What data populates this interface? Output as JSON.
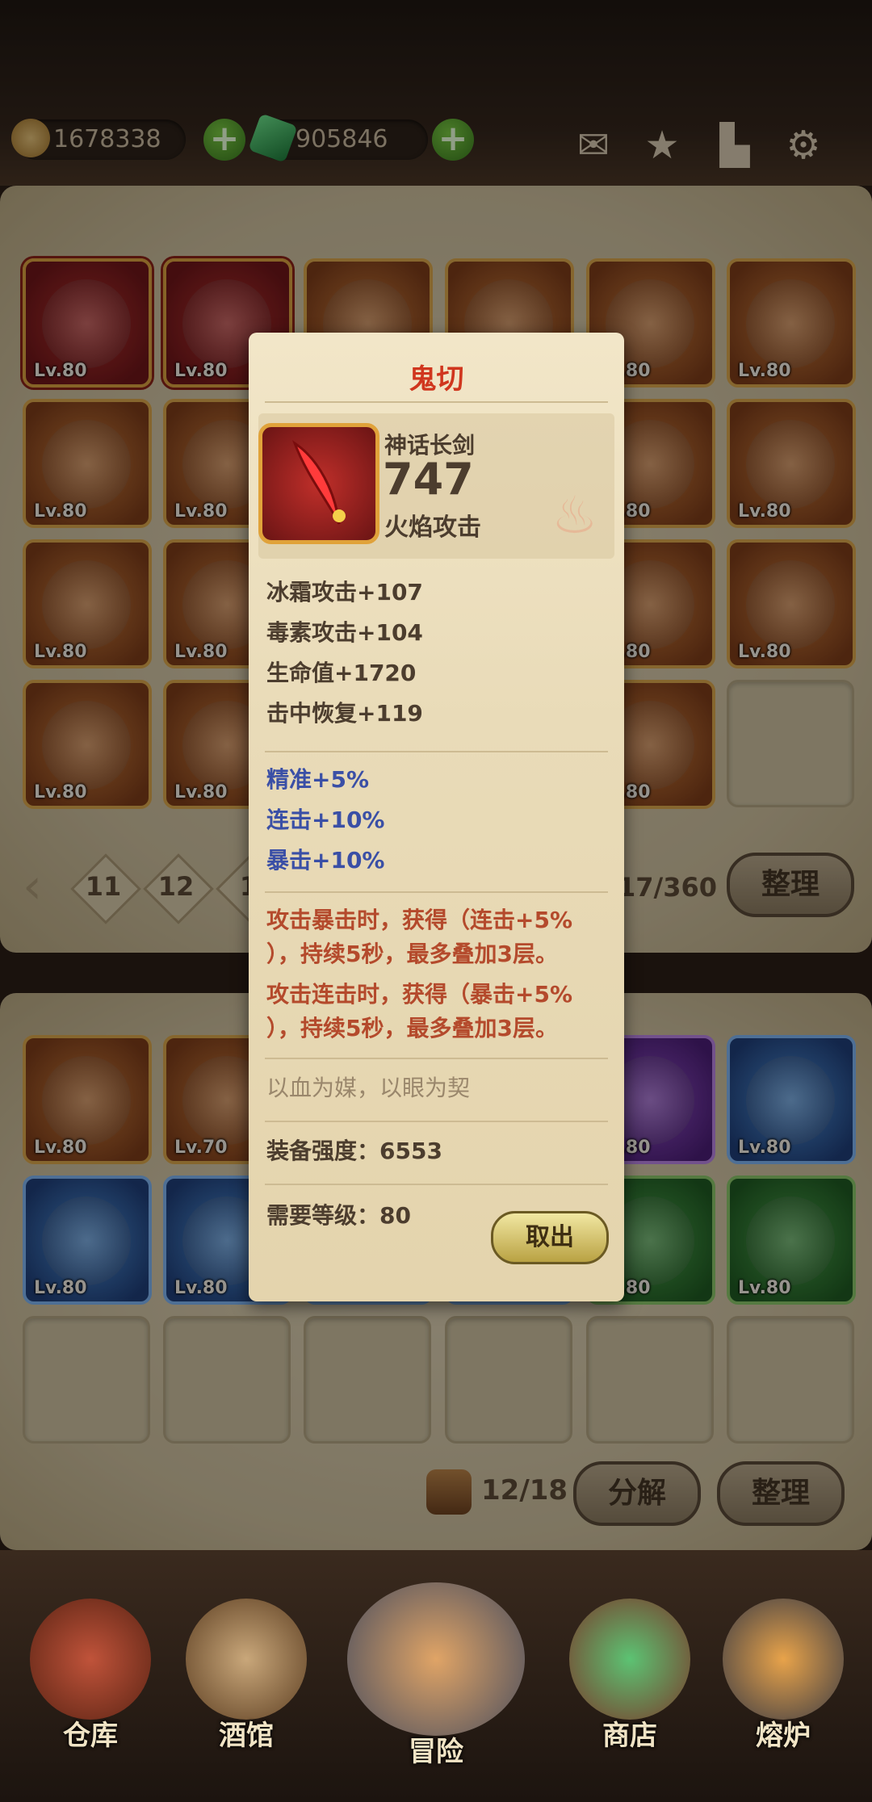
{
  "currency": {
    "coins": "1678338",
    "gems": "905846"
  },
  "storage": {
    "rows": [
      [
        {
          "lv": "Lv.80",
          "rarity": "red"
        },
        {
          "lv": "Lv.80",
          "rarity": "red"
        },
        {
          "lv": "",
          "rarity": "orange"
        },
        {
          "lv": "",
          "rarity": "orange"
        },
        {
          "lv": "Lv.80",
          "rarity": "orange"
        },
        {
          "lv": "Lv.80",
          "rarity": "orange"
        }
      ],
      [
        {
          "lv": "Lv.80",
          "rarity": "orange"
        },
        {
          "lv": "Lv.80",
          "rarity": "orange"
        },
        {
          "lv": "",
          "rarity": "orange"
        },
        {
          "lv": "",
          "rarity": "orange"
        },
        {
          "lv": "Lv.80",
          "rarity": "orange"
        },
        {
          "lv": "Lv.80",
          "rarity": "orange"
        }
      ],
      [
        {
          "lv": "Lv.80",
          "rarity": "orange"
        },
        {
          "lv": "Lv.80",
          "rarity": "orange"
        },
        {
          "lv": "",
          "rarity": "orange"
        },
        {
          "lv": "",
          "rarity": "orange"
        },
        {
          "lv": "Lv.80",
          "rarity": "orange"
        },
        {
          "lv": "Lv.80",
          "rarity": "orange"
        }
      ],
      [
        {
          "lv": "Lv.80",
          "rarity": "orange"
        },
        {
          "lv": "Lv.80",
          "rarity": "orange"
        },
        {
          "lv": "",
          "rarity": "orange"
        },
        {
          "lv": "",
          "rarity": "orange"
        },
        {
          "lv": "Lv.80",
          "rarity": "orange"
        },
        {
          "lv": "",
          "rarity": "empty"
        }
      ]
    ],
    "pages": [
      "11",
      "12",
      "1"
    ],
    "capacity": "17/360",
    "sort_label": "整理"
  },
  "backpack": {
    "rows": [
      [
        {
          "lv": "Lv.80",
          "rarity": "orange"
        },
        {
          "lv": "Lv.70",
          "rarity": "orange"
        },
        {
          "lv": "",
          "rarity": "orange"
        },
        {
          "lv": "",
          "rarity": "orange"
        },
        {
          "lv": "Lv.80",
          "rarity": "purple"
        },
        {
          "lv": "Lv.80",
          "rarity": "blue"
        }
      ],
      [
        {
          "lv": "Lv.80",
          "rarity": "blue"
        },
        {
          "lv": "Lv.80",
          "rarity": "blue"
        },
        {
          "lv": "",
          "rarity": "blue"
        },
        {
          "lv": "",
          "rarity": "blue"
        },
        {
          "lv": "Lv.80",
          "rarity": "green"
        },
        {
          "lv": "Lv.80",
          "rarity": "green"
        }
      ],
      [
        {
          "lv": "",
          "rarity": "empty"
        },
        {
          "lv": "",
          "rarity": "empty"
        },
        {
          "lv": "",
          "rarity": "empty"
        },
        {
          "lv": "",
          "rarity": "empty"
        },
        {
          "lv": "",
          "rarity": "empty"
        },
        {
          "lv": "",
          "rarity": "empty"
        }
      ]
    ],
    "capacity": "12/18",
    "decompose_label": "分解",
    "sort_label": "整理"
  },
  "tooltip": {
    "name": "鬼切",
    "type": "神话长剑",
    "power": "747",
    "element": "火焰攻击",
    "stats": [
      "冰霜攻击+107",
      "毒素攻击+104",
      "生命值+1720",
      "击中恢复+119"
    ],
    "secondary": [
      "精准+5%",
      "连击+10%",
      "暴击+10%"
    ],
    "effects": [
      [
        "攻击暴击时，获得（连击+5%",
        "），持续5秒，最多叠加3层。"
      ],
      [
        "攻击连击时，获得（暴击+5%",
        "），持续5秒，最多叠加3层。"
      ]
    ],
    "flavor": "以血为媒，以眼为契",
    "gear_score": "装备强度：6553",
    "required_level": "需要等级：80",
    "take_out_label": "取出"
  },
  "nav": [
    {
      "label": "仓库",
      "icon": "warehouse-icon"
    },
    {
      "label": "酒馆",
      "icon": "tavern-icon"
    },
    {
      "label": "冒险",
      "icon": "adventure-icon"
    },
    {
      "label": "商店",
      "icon": "shop-icon"
    },
    {
      "label": "熔炉",
      "icon": "furnace-icon"
    }
  ],
  "colors": {
    "accent_red": "#d0361e",
    "blue_stat": "#3a4fa6",
    "effect": "#b44a2c"
  }
}
